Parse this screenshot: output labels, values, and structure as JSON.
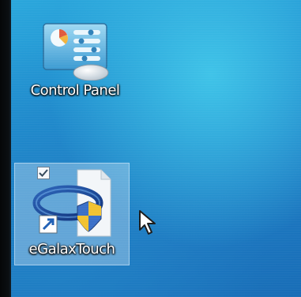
{
  "desktop": {
    "icons": [
      {
        "label": "Control Panel",
        "icon": "control-panel-icon"
      },
      {
        "label": "eGalaxTouch",
        "icon": "egalaxtouch-icon",
        "selected": true,
        "shortcut": true,
        "checked": true
      }
    ]
  },
  "colors": {
    "wallpaper_top": "#2aa7dc",
    "wallpaper_bottom": "#176cb6",
    "selection": "#bedcf0"
  }
}
